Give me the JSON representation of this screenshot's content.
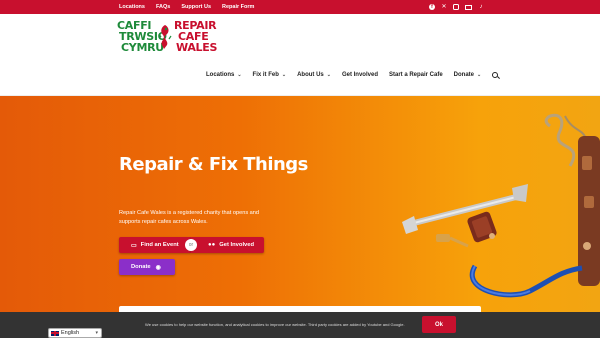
{
  "topbar": {
    "links": [
      "Locations",
      "FAQs",
      "Support Us",
      "Repair Form"
    ],
    "social_icons": [
      "facebook-icon",
      "x-icon",
      "instagram-icon",
      "email-icon",
      "tiktok-icon"
    ]
  },
  "logo": {
    "line1_left": "CAFFI",
    "line1_right": "REPAIR",
    "line2_left": "TRWSIO",
    "line2_right": "CAFE",
    "line3_left": "CYMRU",
    "line3_right": "WALES"
  },
  "nav": {
    "items": [
      {
        "label": "Locations",
        "has_dropdown": true
      },
      {
        "label": "Fix it Feb",
        "has_dropdown": true
      },
      {
        "label": "About Us",
        "has_dropdown": true
      },
      {
        "label": "Get Involved",
        "has_dropdown": false
      },
      {
        "label": "Start a Repair Cafe",
        "has_dropdown": false
      },
      {
        "label": "Donate",
        "has_dropdown": true
      }
    ],
    "chevron": "⌄"
  },
  "hero": {
    "title": "Repair & Fix Things",
    "description": "Repair Cafe Wales is a registered charity that opens and supports repair cafes across Wales.",
    "btn_find": "Find an Event",
    "or_label": "or",
    "btn_involved": "Get Involved",
    "btn_donate": "Donate"
  },
  "cookie": {
    "text": "We use cookies to help our website function, and analytical cookies to improve our website. Third party cookies are added by Youtube and Google.",
    "ok": "Ok"
  },
  "language": {
    "selected": "English"
  },
  "colors": {
    "brand_red": "#c8102e",
    "brand_green": "#1e8a3a",
    "donate_purple": "#8b2fc9",
    "hero_orange": "#ee6f05"
  }
}
